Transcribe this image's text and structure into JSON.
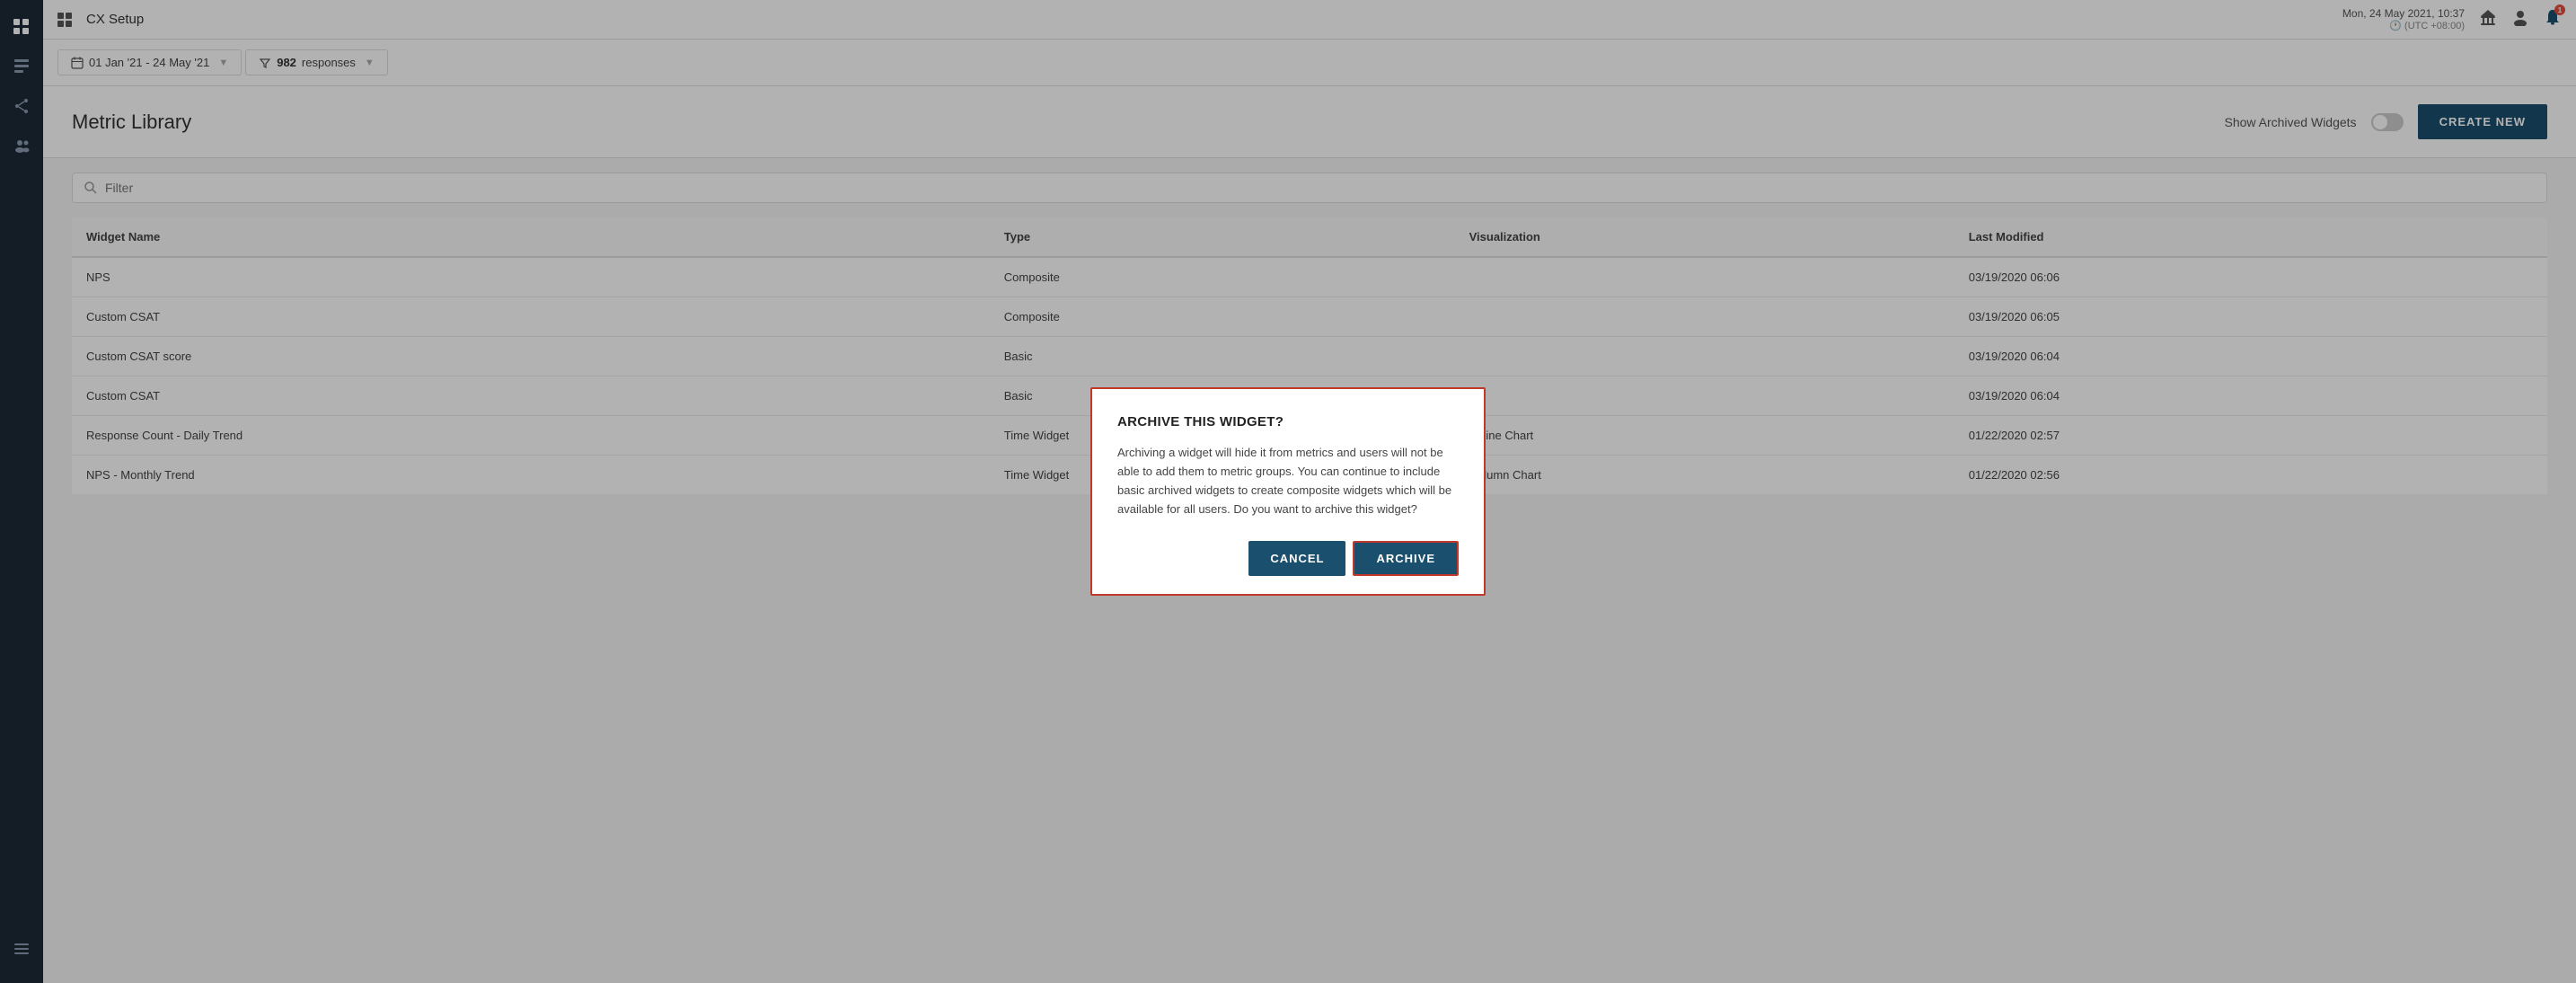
{
  "app": {
    "title": "CX Setup",
    "datetime": "Mon, 24 May 2021, 10:37",
    "timezone": "(UTC +08:00)"
  },
  "filter_bar": {
    "date_range": "01 Jan '21 - 24 May '21",
    "responses_count": "982",
    "responses_label": "responses"
  },
  "page": {
    "title": "Metric Library",
    "show_archived_label": "Show Archived Widgets",
    "create_new_label": "CREATE NEW"
  },
  "search": {
    "placeholder": "Filter"
  },
  "table": {
    "columns": [
      "Widget Name",
      "Type",
      "Visualization",
      "Last Modified"
    ],
    "rows": [
      {
        "name": "NPS",
        "type": "Composite",
        "visualization": "",
        "modified": "03/19/2020 06:06"
      },
      {
        "name": "Custom CSAT",
        "type": "Composite",
        "visualization": "",
        "modified": "03/19/2020 06:05"
      },
      {
        "name": "Custom CSAT score",
        "type": "Basic",
        "visualization": "",
        "modified": "03/19/2020 06:04"
      },
      {
        "name": "Custom CSAT",
        "type": "Basic",
        "visualization": "",
        "modified": "03/19/2020 06:04"
      },
      {
        "name": "Response Count - Daily Trend",
        "type": "Time Widget",
        "visualization": "Spline Chart",
        "modified": "01/22/2020 02:57"
      },
      {
        "name": "NPS - Monthly Trend",
        "type": "Time Widget",
        "visualization": "Column Chart",
        "modified": "01/22/2020 02:56"
      }
    ]
  },
  "modal": {
    "title": "ARCHIVE THIS WIDGET?",
    "body": "Archiving a widget will hide it from metrics and users will not be able to add them to metric groups. You can continue to include basic archived widgets to create composite widgets which will be available for all users. Do you want to archive this widget?",
    "cancel_label": "CANCEL",
    "archive_label": "ARCHIVE"
  },
  "sidebar": {
    "items": [
      {
        "icon": "⊞",
        "name": "grid-icon"
      },
      {
        "icon": "📋",
        "name": "tasks-icon"
      },
      {
        "icon": "↗",
        "name": "share-icon"
      },
      {
        "icon": "👥",
        "name": "users-icon"
      },
      {
        "icon": "⊟",
        "name": "menu-icon"
      }
    ]
  }
}
